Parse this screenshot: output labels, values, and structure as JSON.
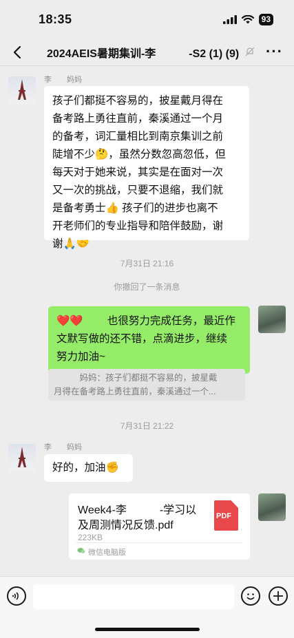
{
  "status": {
    "time": "18:35",
    "battery": "93"
  },
  "nav": {
    "title": "2024AEIS暑期集训-李　　　-S2 (1) (9)"
  },
  "messages": {
    "msg1": {
      "sender": "李　　妈妈",
      "lines": [
        "孩子们都挺不容易的，披星戴月得在",
        "备考路上勇往直前，秦溪通过一个月",
        "的备考，词汇量相比到南京集训之前",
        "陡增不少🤔，虽然分数忽高忽低，但",
        "每天对于她来说，其实是在面对一次",
        "又一次的挑战，只要不退缩，我们就",
        "是备考勇士👍 孩子们的进步也离不",
        "开老师们的专业指导和陪伴鼓励，谢",
        "谢🙏🤝"
      ]
    },
    "time1": "7月31日 21:16",
    "recall": "你撤回了一条消息",
    "msg2": {
      "lines": [
        "❤️❤️ 　　也很努力完成任务，最近作",
        "文默写做的还不错，点滴进步，继续",
        "努力加油~"
      ],
      "quote_lines": [
        "　　　妈妈：孩子们都挺不容易的，披星戴",
        "月得在备考路上勇往直前，秦溪通过一个..."
      ]
    },
    "time2": "7月31日 21:22",
    "msg3": {
      "sender": "李　　妈妈",
      "text": "好的，加油✊"
    },
    "file": {
      "name_line1": "Week4-李　　　-学习以",
      "name_line2": "及周测情况反馈.pdf",
      "size": "223KB",
      "pdf_label": "PDF",
      "source": "微信电脑版"
    }
  },
  "colors": {
    "green_bubble": "#95ec69",
    "pdf_red": "#e8484a",
    "background": "#ededed"
  }
}
